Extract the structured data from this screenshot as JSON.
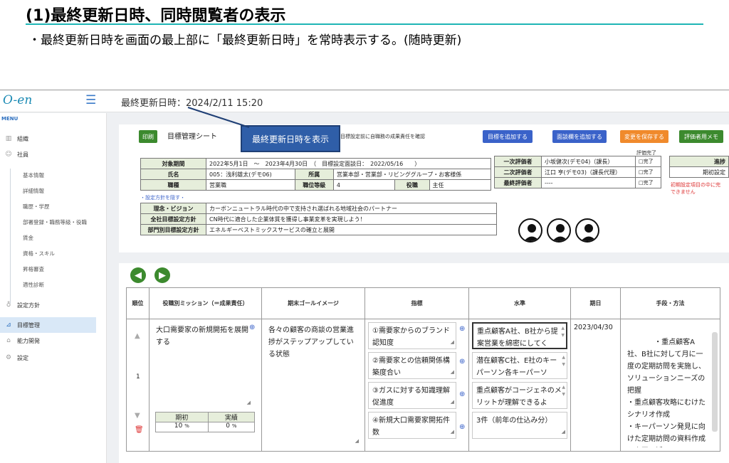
{
  "slide": {
    "title": "(1)最終更新日時、同時閲覧者の表示",
    "subtitle": "・最終更新日時を画面の最上部に「最終更新日時」を常時表示する。(随時更新)"
  },
  "app": {
    "logo": "O-en",
    "last_updated": "最終更新日時：2024/2/11 15:20",
    "sidebar": {
      "menu_label": "MENU",
      "top_items": [
        {
          "icon": "building-icon",
          "label": "組織"
        },
        {
          "icon": "people-icon",
          "label": "社員"
        }
      ],
      "sub_items": [
        "基本情報",
        "詳細情報",
        "職歴・学歴",
        "部署登録・職務等級・役職",
        "賃金",
        "資格・スキル",
        "昇格審査",
        "適性診断"
      ],
      "bottom_items": [
        {
          "icon": "bulb-icon",
          "label": "設定方針"
        },
        {
          "icon": "chart-icon",
          "label": "目標管理"
        },
        {
          "icon": "mortarboard-icon",
          "label": "能力開発"
        },
        {
          "icon": "gear-icon",
          "label": "設定"
        }
      ]
    },
    "sheet": {
      "print_button": "印刷",
      "title": "目標管理シート",
      "callout": "最終更新日時を表示",
      "confirm_text": "目標設定前に自職務の成果責任を確認",
      "buttons": {
        "add_goal": "目標を追加する",
        "add_task": "面談欄を追加する",
        "save": "変更を保存する",
        "memo": "評価者用メモ"
      },
      "info": {
        "period_label": "対象期間",
        "period_value": "2022年5月1日　～　2023年4月30日　（　目標設定面談日：　2022/05/16　　）",
        "name_label": "氏名",
        "name_value": "005：浅利雄太(デモ06)",
        "dept_label": "所属",
        "dept_value": "営業本部・営業部・リビンググループ・お客様係",
        "job_label": "職種",
        "job_value": "営業職",
        "grade_label": "職位等級",
        "grade_value": "4",
        "role_label": "役職",
        "role_value": "主任"
      },
      "evaluators": {
        "complete_header": "評価完了",
        "rows": [
          {
            "label": "一次評価者",
            "value": "小坂健次(デモ04)（課長）",
            "check": "□完了"
          },
          {
            "label": "二次評価者",
            "value": "江口 亨(デモ03)（課長代理）",
            "check": "□完了"
          },
          {
            "label": "最終評価者",
            "value": "----",
            "check": "□完了"
          }
        ]
      },
      "progress": {
        "header": "進捗",
        "value": "期初設定",
        "warning_line1": "初期設定項目の中に完",
        "warning_line2": "できません"
      },
      "policy_link": "・設定方針を隠す・",
      "policies": [
        {
          "label": "理念・ビジョン",
          "value": "カーボンニュートラル時代の中で支持され選ばれる地域社会のパートナー"
        },
        {
          "label": "全社目標設定方針",
          "value": "CN時代に適合した企業体質を獲得し事業変革を実現しよう！"
        },
        {
          "label": "部門別目標設定方針",
          "value": "エネルギーベストミックスサービスの確立と展開"
        }
      ]
    },
    "goals": {
      "headers": [
        "順位",
        "役職別ミッション（＝成果責任）",
        "期末ゴールイメージ",
        "指標",
        "水準",
        "期日",
        "手段・方法"
      ],
      "row": {
        "rank": "1",
        "mission": "大口需要家の新規開拓を展開する",
        "goal_image": "各々の顧客の商談の営業進捗がステップアップしている状態",
        "indicators": [
          "①需要家からのブランド認知度",
          "②需要家との信頼関係構築度合い",
          "③ガスに対する知識理解促進度",
          "④新規大口需要家開拓件数"
        ],
        "levels": [
          "重点顧客A社、B社から提案営業を綿密にしてく",
          "潜在顧客C社、E社のキーパーソン各キーパーソ",
          "重点顧客がコージェネのメリットが理解できるよ",
          "3件（前年の仕込み分）"
        ],
        "due_date": "2023/04/30",
        "methods": "・重点顧客A社、B社に対して月に一度の定期訪問を実施し、ソリューションニーズの把握\n・重点顧客攻略にむけたシナリオ作成\n・キーパーソン発見に向けた定期訪問の資料作成と上司の活用\n・コージェネに関する外部情報収集と顧客への情",
        "weight_header_initial": "期初",
        "weight_header_actual": "実績",
        "weight_initial": "10",
        "weight_actual": "0",
        "unit": "%"
      }
    }
  }
}
